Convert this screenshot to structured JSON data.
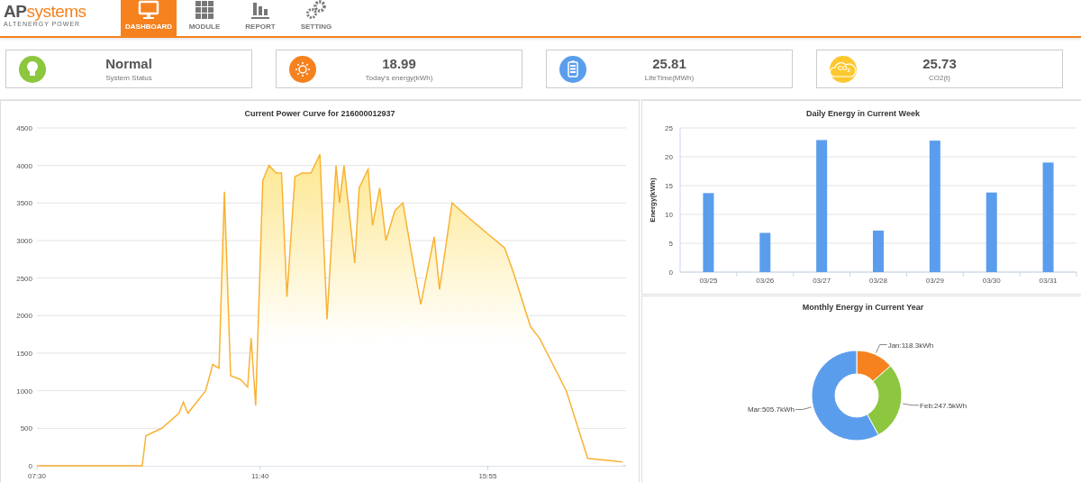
{
  "header": {
    "logo": {
      "part_1": "AP",
      "part_2": "systems",
      "tagline": "ALTENERGY POWER"
    },
    "tabs": [
      {
        "label": "DASHBOARD",
        "selected": true
      },
      {
        "label": "MODULE",
        "selected": false
      },
      {
        "label": "REPORT",
        "selected": false
      },
      {
        "label": "SETTING",
        "selected": false
      }
    ]
  },
  "cards": [
    {
      "value": "Normal",
      "label": "System Status",
      "color": "#8dc63f"
    },
    {
      "value": "18.99",
      "label": "Today's energy(kWh)",
      "color": "#f5821f"
    },
    {
      "value": "25.81",
      "label": "LifeTime(MWh)",
      "color": "#5b9ded"
    },
    {
      "value": "25.73",
      "label": "CO2(t)",
      "icon_text": "CO$_{2}$",
      "color": "#fdc82f"
    }
  ],
  "power_curve": {
    "chart_data": {
      "type": "area",
      "title": "Current Power Curve for 216000012937",
      "grid": true,
      "x": [
        450,
        568,
        572,
        590,
        609,
        614,
        619,
        629,
        639,
        647,
        654,
        660,
        667,
        678,
        686,
        690,
        695,
        703,
        710,
        718,
        724,
        730,
        739,
        747,
        757,
        767,
        775,
        785,
        789,
        794,
        806,
        811,
        821,
        826,
        834,
        841,
        851,
        860,
        870,
        880,
        895,
        901,
        915,
        934,
        954,
        974,
        983,
        1003,
        1013,
        1043,
        1067,
        1106
      ],
      "series": [
        {
          "color": "#f9b233",
          "values": [
            0,
            0,
            400,
            500,
            700,
            850,
            700,
            850,
            1000,
            1350,
            1300,
            3650,
            1200,
            1150,
            1050,
            1700,
            800,
            3800,
            4000,
            3900,
            3900,
            2250,
            3850,
            3900,
            3900,
            4150,
            1950,
            4000,
            3500,
            4000,
            2700,
            3700,
            3950,
            3200,
            3700,
            3000,
            3400,
            3500,
            2800,
            2150,
            3050,
            2350,
            3500,
            3300,
            3100,
            2900,
            2600,
            1850,
            1700,
            1000,
            100,
            50
          ]
        }
      ],
      "xlim": [
        450,
        1110
      ],
      "ylim": [
        0,
        4500
      ],
      "xticks": [
        {
          "value": 450,
          "label": "07:30"
        },
        {
          "value": 700,
          "label": "11:40"
        },
        {
          "value": 955,
          "label": "15:55"
        }
      ],
      "yticks": [
        0,
        500,
        1000,
        1500,
        2000,
        2500,
        3000,
        3500,
        4000,
        4500
      ]
    }
  },
  "daily_energy": {
    "chart_data": {
      "type": "bar",
      "title": "Daily Energy in Current Week",
      "ylabel": "Energy(kWh)",
      "grid": true,
      "categories": [
        "03/25",
        "03/26",
        "03/27",
        "03/28",
        "03/29",
        "03/30",
        "03/31"
      ],
      "series": [
        {
          "color": "#5b9ded",
          "values": [
            13.7,
            6.8,
            22.9,
            7.2,
            22.8,
            13.8,
            19.0
          ]
        }
      ],
      "ylim": [
        0,
        25
      ],
      "yticks": [
        0,
        5,
        10,
        15,
        20,
        25
      ]
    }
  },
  "monthly_energy": {
    "chart_data": {
      "type": "donut",
      "title": "Monthly Energy in Current Year",
      "values": [
        118.3,
        247.5,
        505.7
      ],
      "colors": [
        "#f5821f",
        "#8dc63f",
        "#5b9ded"
      ],
      "value_labels": [
        "Jan:118.3kWh",
        "Feb:247.5kWh",
        "Mar:505.7kWh"
      ]
    }
  }
}
